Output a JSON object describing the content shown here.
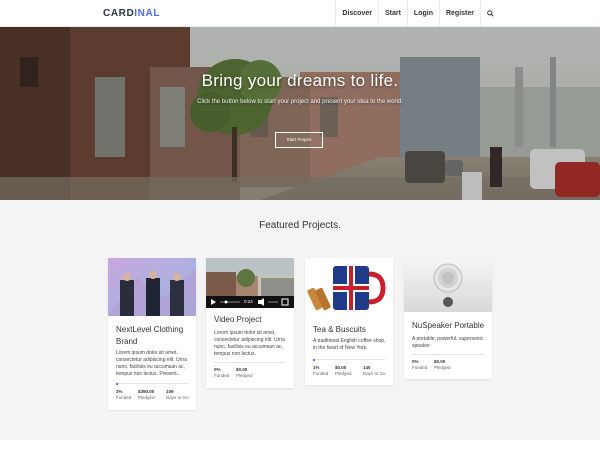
{
  "brand": {
    "part1": "CARD",
    "part2": "INAL",
    "accent_color": "#4a6cf7"
  },
  "nav": {
    "items": [
      "Discover",
      "Start",
      "Login",
      "Register"
    ],
    "search_icon": "search-icon"
  },
  "hero": {
    "title": "Bring your dreams to life.",
    "subtitle": "Click the button below to start your project and present your idea to the world.",
    "button": "Start Project"
  },
  "featured": {
    "title": "Featured Projects.",
    "cards": [
      {
        "title": "NextLevel Clothing Brand",
        "description": "Lorem ipsum dolor sit amet, consectetur adipiscing elit. Urna nunc, facilisis eu accumsan ac, tempus non lectus. Present...",
        "stats": [
          {
            "num": "2%",
            "label": "Funded"
          },
          {
            "num": "$350.00",
            "label": "Pledged"
          },
          {
            "num": "109",
            "label": "Days to Go"
          }
        ],
        "funded_fraction": 0.02
      },
      {
        "title": "Video Project",
        "description": "Lorem ipsum dolor sit amet, consectetur adipiscing elit. Urna nunc, facilisis eu accumsan ac, tempus non lectus.",
        "video_time": "0:24",
        "stats": [
          {
            "num": "0%",
            "label": "Funded"
          },
          {
            "num": "$0.00",
            "label": "Pledged"
          }
        ],
        "funded_fraction": 0
      },
      {
        "title": "Tea & Buscuits",
        "description": "A traditional English coffee shop, in the heart of New York.",
        "stats": [
          {
            "num": "1%",
            "label": "Funded"
          },
          {
            "num": "$0.00",
            "label": "Pledged"
          },
          {
            "num": "140",
            "label": "Days to Go"
          }
        ],
        "funded_fraction": 0.01
      },
      {
        "title": "NuSpeaker Portable",
        "description": "A portable, powerful, supersonic speaker.",
        "stats": [
          {
            "num": "0%",
            "label": "Funded"
          },
          {
            "num": "$0.00",
            "label": "Pledged"
          }
        ],
        "funded_fraction": 0
      }
    ]
  }
}
